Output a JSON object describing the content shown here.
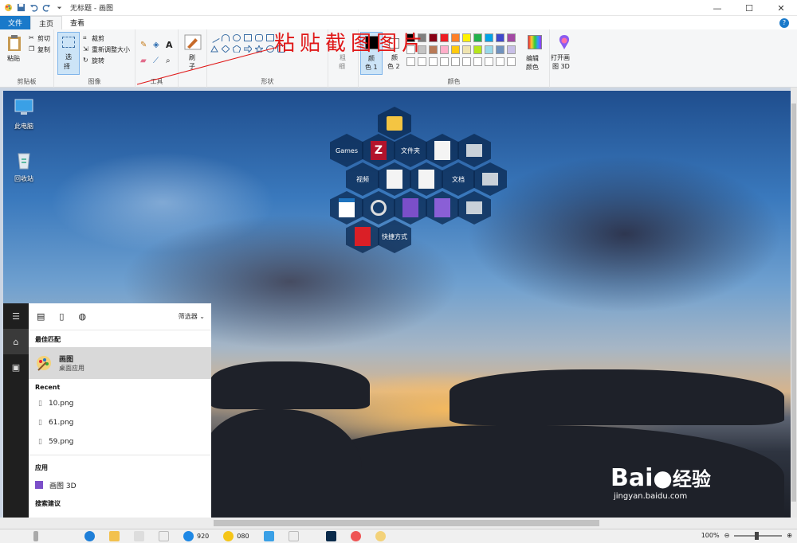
{
  "window": {
    "title": "无标题 - 画图",
    "controls": {
      "minimize": "—",
      "maximize": "☐",
      "close": "✕"
    }
  },
  "quick_access": {
    "icons": [
      "paint-icon",
      "save-icon",
      "undo-icon",
      "redo-icon",
      "customize-icon"
    ]
  },
  "tabs": [
    {
      "label": "文件",
      "state": "file"
    },
    {
      "label": "主页",
      "state": "active"
    },
    {
      "label": "查看",
      "state": "normal"
    }
  ],
  "ribbon": {
    "clipboard": {
      "paste": "粘贴",
      "cut": "剪切",
      "copy": "复制",
      "group": "剪贴板"
    },
    "image": {
      "select": "选",
      "select2": "择",
      "crop": "裁剪",
      "resize": "重新调整大小",
      "rotate": "旋转",
      "group": "图像"
    },
    "tools": {
      "group": "工具"
    },
    "brushes": {
      "label": "刷",
      "label2": "子"
    },
    "shapes": {
      "group": "形状"
    },
    "annotation": "粘贴截图图片",
    "size": {
      "label": "粗",
      "label2": "细"
    },
    "colors": {
      "color1": "颜",
      "color1b": "色 1",
      "color2": "颜",
      "color2b": "色 2",
      "edit": "编辑",
      "edit2": "颜色",
      "group": "颜色",
      "palette_row1": [
        "#000000",
        "#7f7f7f",
        "#880015",
        "#ed1c24",
        "#ff7f27",
        "#fff200",
        "#22b14c",
        "#00a2e8",
        "#3f48cc",
        "#a349a4"
      ],
      "palette_row2": [
        "#ffffff",
        "#c3c3c3",
        "#b97a57",
        "#ffaec9",
        "#ffc90e",
        "#efe4b0",
        "#b5e61d",
        "#99d9ea",
        "#7092be",
        "#c8bfe7"
      ]
    },
    "paint3d": {
      "label": "打开画",
      "label2": "图 3D"
    }
  },
  "desktop": {
    "icons": [
      {
        "label": "此电脑"
      },
      {
        "label": "回收站"
      }
    ],
    "hex_menu": {
      "games": "Games",
      "folder": "文件夹",
      "video": "视频",
      "docs": "文档",
      "shortcuts": "快捷方式"
    }
  },
  "start_menu": {
    "filter": "筛选器",
    "best_match_heading": "最佳匹配",
    "best_match": {
      "name": "画图",
      "type": "桌面应用"
    },
    "recent_heading": "Recent",
    "recent": [
      "10.png",
      "61.png",
      "59.png"
    ],
    "apps_heading": "应用",
    "apps": [
      "画图 3D"
    ],
    "suggest_heading": "搜索建议"
  },
  "taskbar": {
    "items": [
      "920",
      "080"
    ]
  },
  "statusbar": {
    "zoom": "100%"
  },
  "watermark": {
    "brand": "Bai",
    "brand2": "经验",
    "url": "jingyan.baidu.com"
  }
}
